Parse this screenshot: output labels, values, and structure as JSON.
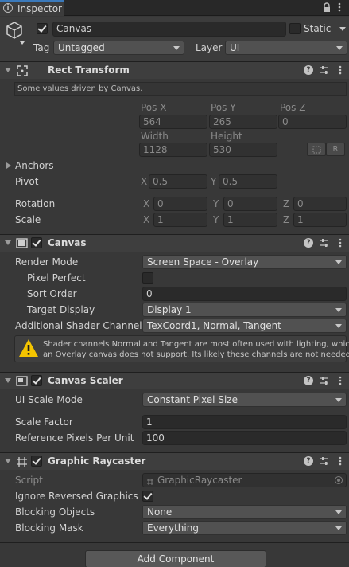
{
  "tab": {
    "title": "Inspector"
  },
  "header": {
    "object_name": "Canvas",
    "static_label": "Static",
    "tag_label": "Tag",
    "tag_value": "Untagged",
    "layer_label": "Layer",
    "layer_value": "UI"
  },
  "rect_transform": {
    "title": "Rect Transform",
    "note": "Some values driven by Canvas.",
    "pos_x_label": "Pos X",
    "pos_y_label": "Pos Y",
    "pos_z_label": "Pos Z",
    "pos_x": "564",
    "pos_y": "265",
    "pos_z": "0",
    "width_label": "Width",
    "height_label": "Height",
    "width": "1128",
    "height": "530",
    "r_button": "R",
    "anchors_label": "Anchors",
    "pivot_label": "Pivot",
    "pivot_x_label": "X",
    "pivot_x": "0.5",
    "pivot_y_label": "Y",
    "pivot_y": "0.5",
    "rotation_label": "Rotation",
    "rot_x_label": "X",
    "rot_x": "0",
    "rot_y_label": "Y",
    "rot_y": "0",
    "rot_z_label": "Z",
    "rot_z": "0",
    "scale_label": "Scale",
    "scale_x_label": "X",
    "scale_x": "1",
    "scale_y_label": "Y",
    "scale_y": "1",
    "scale_z_label": "Z",
    "scale_z": "1"
  },
  "canvas": {
    "title": "Canvas",
    "render_mode_label": "Render Mode",
    "render_mode": "Screen Space - Overlay",
    "pixel_perfect_label": "Pixel Perfect",
    "sort_order_label": "Sort Order",
    "sort_order": "0",
    "target_display_label": "Target Display",
    "target_display": "Display 1",
    "shader_channels_label": "Additional Shader Channels",
    "shader_channels": "TexCoord1, Normal, Tangent",
    "warning_line1": "Shader channels Normal and Tangent are most often used with lighting, which",
    "warning_line2": "an Overlay canvas does not support. Its likely these channels are not needed."
  },
  "canvas_scaler": {
    "title": "Canvas Scaler",
    "ui_scale_mode_label": "UI Scale Mode",
    "ui_scale_mode": "Constant Pixel Size",
    "scale_factor_label": "Scale Factor",
    "scale_factor": "1",
    "ref_ppu_label": "Reference Pixels Per Unit",
    "ref_ppu": "100"
  },
  "graphic_raycaster": {
    "title": "Graphic Raycaster",
    "script_label": "Script",
    "script_value": "GraphicRaycaster",
    "ignore_reversed_label": "Ignore Reversed Graphics",
    "blocking_objects_label": "Blocking Objects",
    "blocking_objects": "None",
    "blocking_mask_label": "Blocking Mask",
    "blocking_mask": "Everything"
  },
  "add_component_label": "Add Component",
  "colors": {
    "panel_bg": "#383838",
    "header_bg": "#3e3e3e",
    "field_bg": "#2a2a2a",
    "warning_yellow": "#f4c400"
  }
}
